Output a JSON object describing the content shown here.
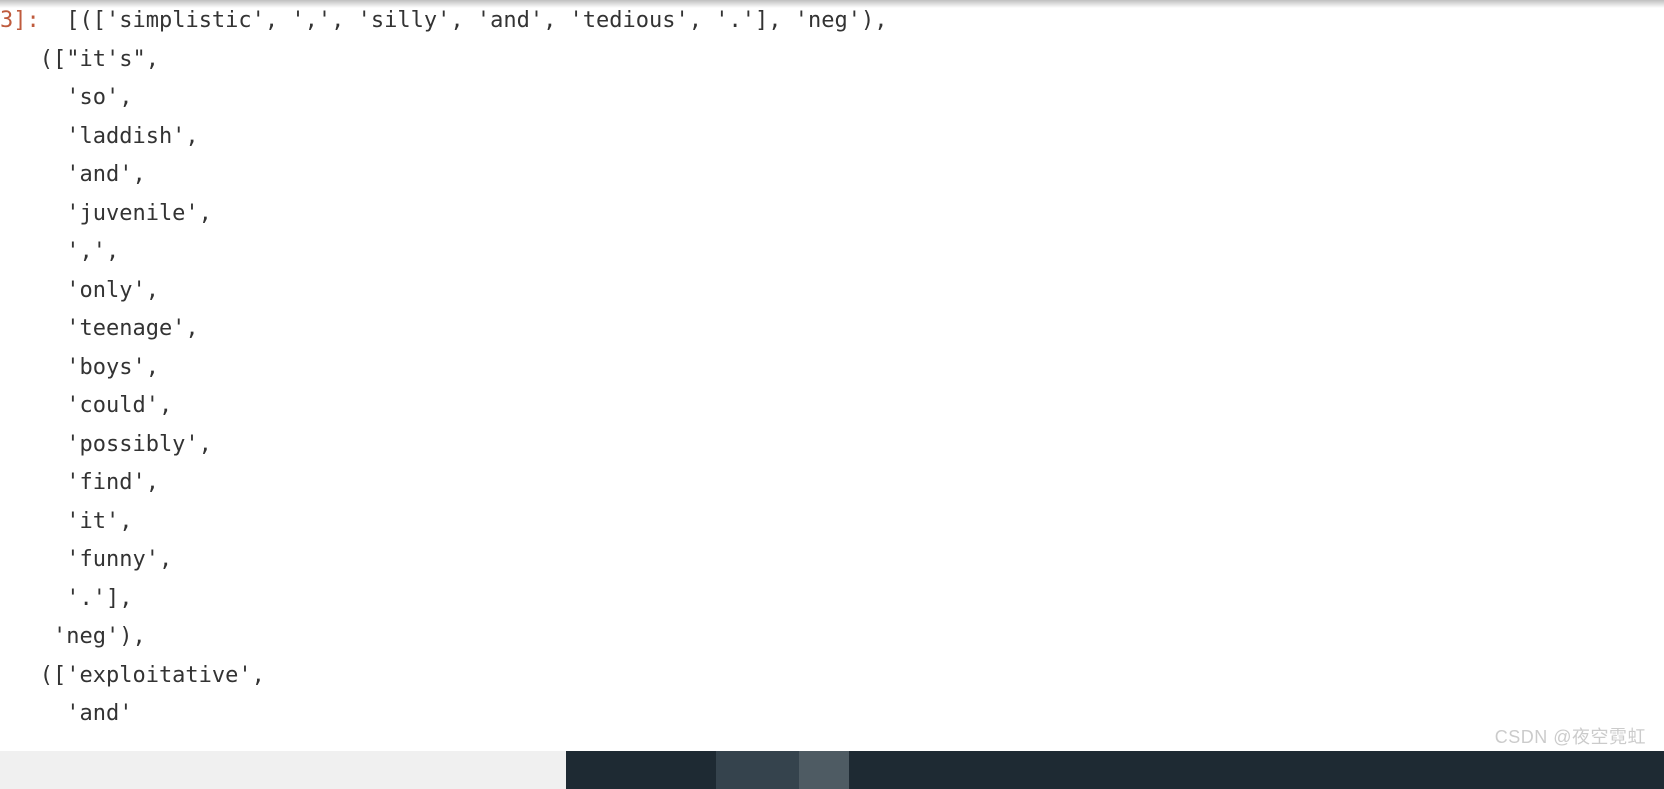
{
  "output": {
    "prompt_partial": "3]:",
    "lines": [
      "  [(['simplistic', ',', 'silly', 'and', 'tedious', '.'], 'neg'),",
      "   ([\"it's\",",
      "     'so',",
      "     'laddish',",
      "     'and',",
      "     'juvenile',",
      "     ',',",
      "     'only',",
      "     'teenage',",
      "     'boys',",
      "     'could',",
      "     'possibly',",
      "     'find',",
      "     'it',",
      "     'funny',",
      "     '.'],",
      "    'neg'),",
      "   (['exploitative',",
      "     'and'"
    ]
  },
  "watermark": "CSDN @夜空霓虹"
}
